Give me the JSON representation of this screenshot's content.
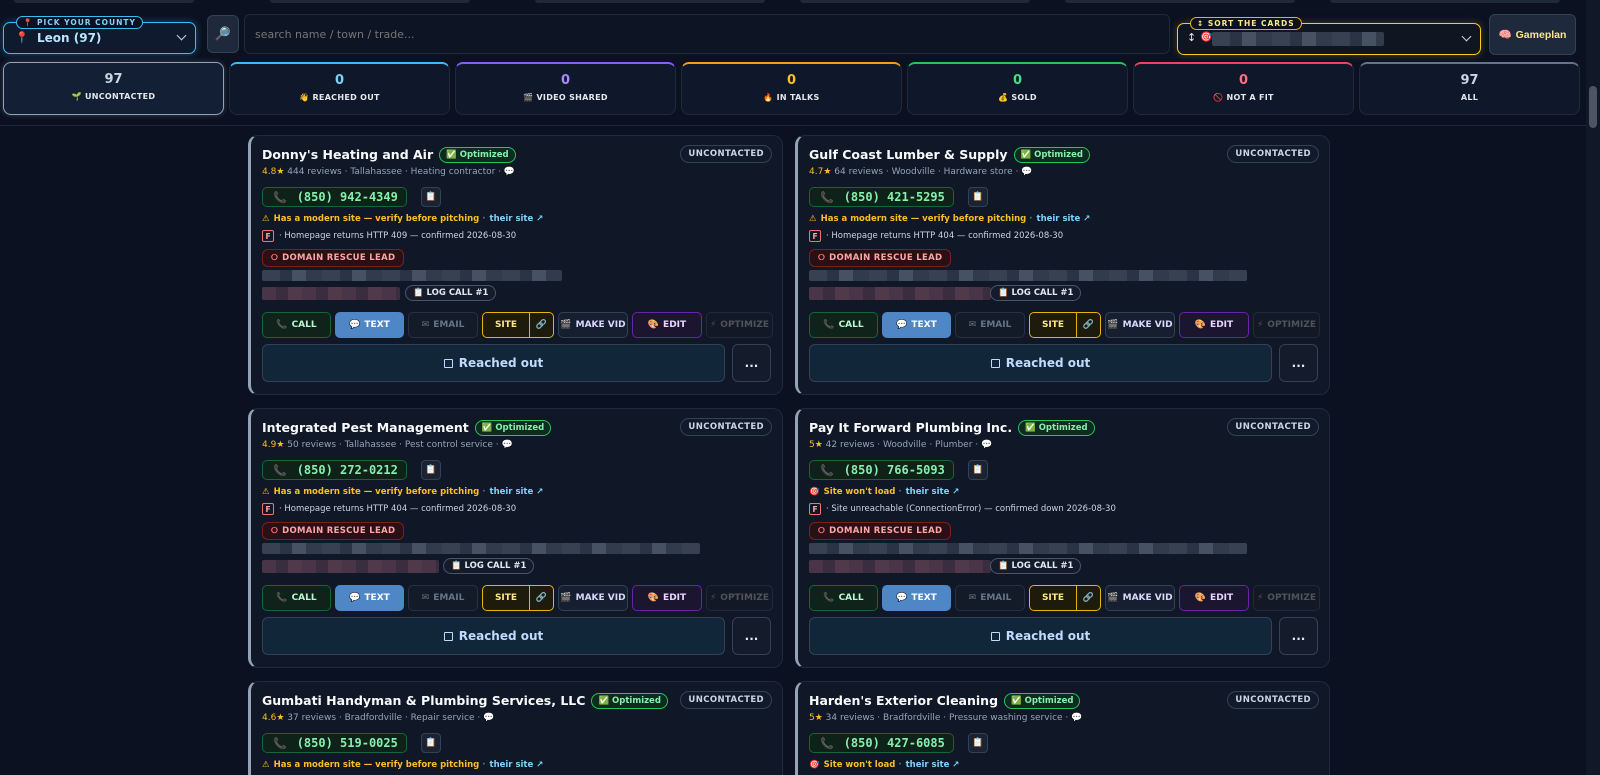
{
  "toolbar": {
    "county_label": "📍 PICK YOUR COUNTY",
    "county_value": "Leon (97)",
    "search_icon": "🔎",
    "search_placeholder": "search name / town / trade...",
    "sort_label": "↕ SORT THE CARDS",
    "sort_arrows": "↕",
    "sort_icon": "🎯",
    "gameplan_icon": "🧠",
    "gameplan_label": "Gameplan"
  },
  "stats": [
    {
      "count": "97",
      "icon": "🌱",
      "label": "UNCONTACTED",
      "color": "#cbd5e1",
      "accent": "#94a3b8"
    },
    {
      "count": "0",
      "icon": "👋",
      "label": "REACHED OUT",
      "color": "#7dd3fc",
      "accent": "#38bdf8"
    },
    {
      "count": "0",
      "icon": "🎬",
      "label": "VIDEO SHARED",
      "color": "#a78bfa",
      "accent": "#8b5cf6"
    },
    {
      "count": "0",
      "icon": "🔥",
      "label": "IN TALKS",
      "color": "#fbbf24",
      "accent": "#f59e0b"
    },
    {
      "count": "0",
      "icon": "💰",
      "label": "SOLD",
      "color": "#4ade80",
      "accent": "#22c55e"
    },
    {
      "count": "0",
      "icon": "🚫",
      "label": "NOT A FIT",
      "color": "#fb7185",
      "accent": "#f43f5e"
    },
    {
      "count": "97",
      "icon": "",
      "label": "ALL",
      "color": "#cbd5e1",
      "accent": "#64748b"
    }
  ],
  "card_labels": {
    "optimized": "Optimized",
    "optimized_icon": "✅",
    "status": "UNCONTACTED",
    "phone_icon": "📞",
    "copy_icon": "📋",
    "their_site": "their site ↗",
    "grade": "F",
    "rescue_icon": "⭘",
    "rescue": "DOMAIN RESCUE LEAD",
    "log_call": "📋 LOG CALL #1",
    "call_icon": "📞",
    "call": "CALL",
    "text_icon": "💬",
    "text": "TEXT",
    "email_icon": "✉",
    "email": "EMAIL",
    "site": "SITE",
    "link_icon": "🔗",
    "vid_icon": "🎬",
    "make_vid": "MAKE VID",
    "edit_icon": "🎨",
    "edit": "EDIT",
    "opt_icon": "⚡",
    "optimize": "OPTIMIZE",
    "reached_out": "Reached out",
    "more": "..."
  },
  "cards": [
    {
      "name": "Donny's Heating and Air",
      "rating": "4.8★",
      "meta": " 444 reviews · Tallahassee · Heating contractor · 💬",
      "phone": "(850) 942-4349",
      "warn_icon": "⚠",
      "warn": "Has a modern site — verify before pitching",
      "grade_text": "· Homepage returns HTTP 409 — confirmed 2026-08-30"
    },
    {
      "name": "Gulf Coast Lumber & Supply",
      "rating": "4.7★",
      "meta": " 64 reviews · Woodville · Hardware store · 💬",
      "phone": "(850) 421-5295",
      "warn_icon": "⚠",
      "warn": "Has a modern site — verify before pitching",
      "grade_text": "· Homepage returns HTTP 404 — confirmed 2026-08-30"
    },
    {
      "name": "Integrated Pest Management",
      "rating": "4.9★",
      "meta": " 50 reviews · Tallahassee · Pest control service · 💬",
      "phone": "(850) 272-0212",
      "warn_icon": "⚠",
      "warn": "Has a modern site — verify before pitching",
      "grade_text": "· Homepage returns HTTP 404 — confirmed 2026-08-30"
    },
    {
      "name": "Pay It Forward Plumbing Inc.",
      "rating": "5★",
      "meta": " 42 reviews · Woodville · Plumber · 💬",
      "phone": "(850) 766-5093",
      "warn_icon": "🎯",
      "warn": "Site won't load",
      "grade_text": "· Site unreachable (ConnectionError) — confirmed down 2026-08-30"
    },
    {
      "name": "Gumbati Handyman & Plumbing Services, LLC",
      "rating": "4.6★",
      "meta": " 37 reviews · Bradfordville · Repair service · 💬",
      "phone": "(850) 519-0025",
      "warn_icon": "⚠",
      "warn": "Has a modern site — verify before pitching"
    },
    {
      "name": "Harden's Exterior Cleaning",
      "rating": "5★",
      "meta": " 34 reviews · Bradfordville · Pressure washing service · 💬",
      "phone": "(850) 427-6085",
      "warn_icon": "🎯",
      "warn": "Site won't load"
    }
  ]
}
